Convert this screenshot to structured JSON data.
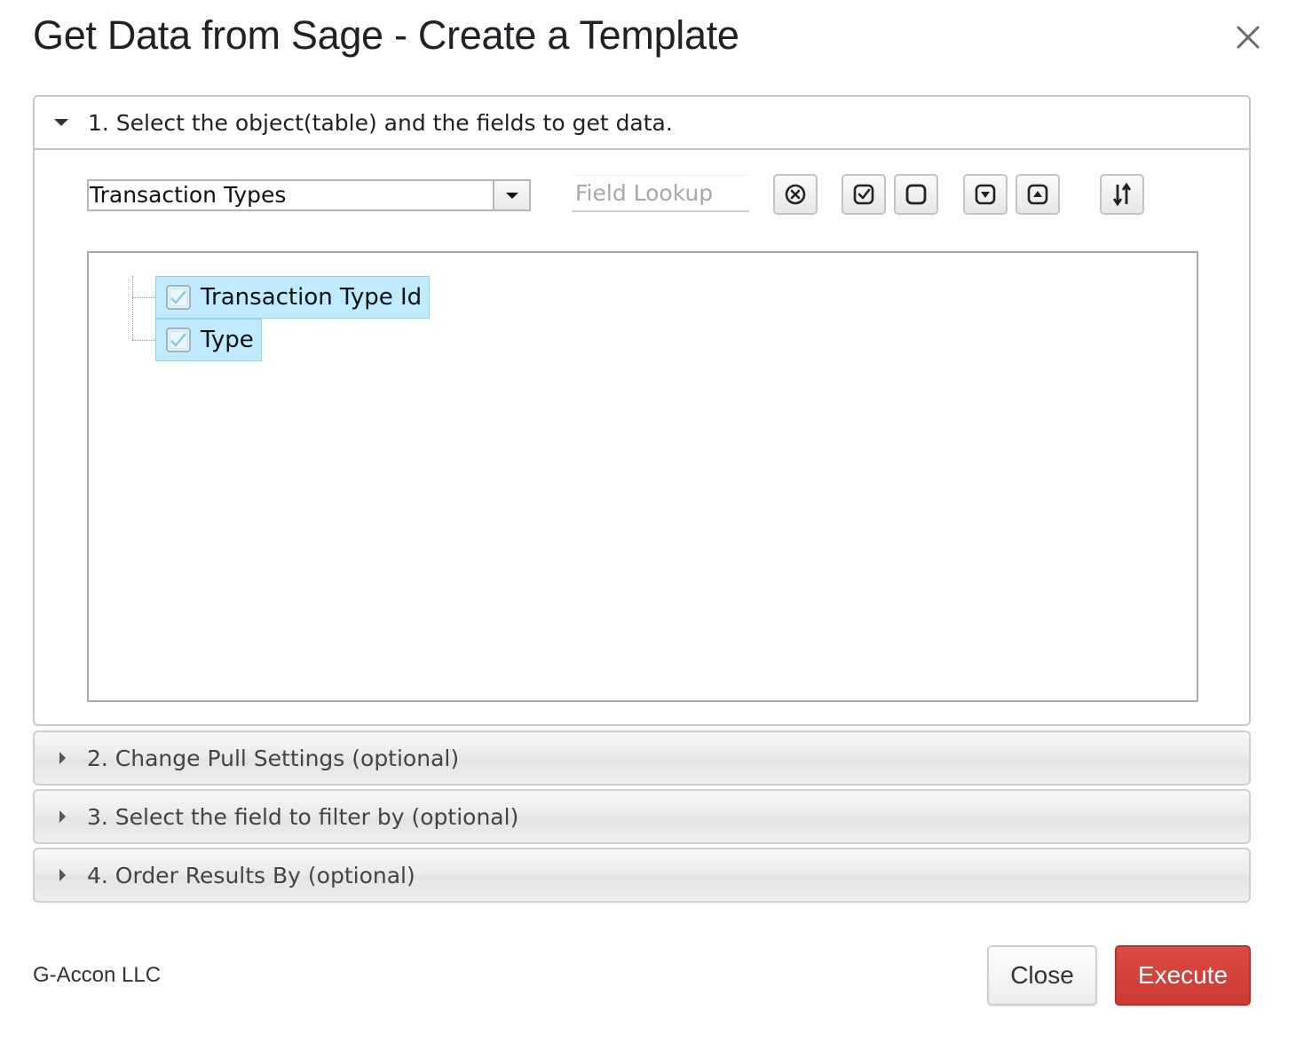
{
  "dialog": {
    "title": "Get Data from Sage - Create a Template",
    "close_icon": "close-icon"
  },
  "section1": {
    "label": "1. Select the object(table) and the fields to get data.",
    "expanded": true,
    "object_select": {
      "value": "Transaction Types"
    },
    "field_lookup": {
      "placeholder": "Field Lookup",
      "value": ""
    },
    "toolbar": [
      {
        "name": "clear-icon"
      },
      {
        "name": "check-all-icon"
      },
      {
        "name": "uncheck-all-icon"
      },
      {
        "name": "move-down-icon"
      },
      {
        "name": "move-up-icon"
      },
      {
        "name": "sort-icon"
      }
    ],
    "fields": [
      {
        "label": "Transaction Type Id",
        "checked": true
      },
      {
        "label": "Type",
        "checked": true
      }
    ]
  },
  "section2": {
    "label": "2. Change Pull Settings (optional)"
  },
  "section3": {
    "label": "3. Select the field to filter by (optional)"
  },
  "section4": {
    "label": "4. Order Results By (optional)"
  },
  "footer": {
    "company": "G-Accon LLC",
    "close_label": "Close",
    "execute_label": "Execute"
  },
  "colors": {
    "execute": "#cf3d36",
    "selection": "#bfeaff"
  }
}
